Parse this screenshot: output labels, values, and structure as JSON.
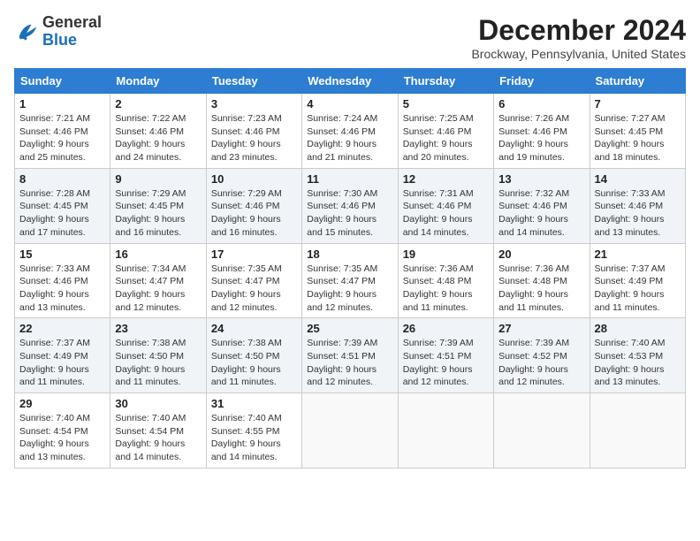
{
  "logo": {
    "general": "General",
    "blue": "Blue"
  },
  "title": "December 2024",
  "subtitle": "Brockway, Pennsylvania, United States",
  "days_of_week": [
    "Sunday",
    "Monday",
    "Tuesday",
    "Wednesday",
    "Thursday",
    "Friday",
    "Saturday"
  ],
  "weeks": [
    [
      {
        "day": 1,
        "sunrise": "7:21 AM",
        "sunset": "4:46 PM",
        "daylight": "9 hours and 25 minutes."
      },
      {
        "day": 2,
        "sunrise": "7:22 AM",
        "sunset": "4:46 PM",
        "daylight": "9 hours and 24 minutes."
      },
      {
        "day": 3,
        "sunrise": "7:23 AM",
        "sunset": "4:46 PM",
        "daylight": "9 hours and 23 minutes."
      },
      {
        "day": 4,
        "sunrise": "7:24 AM",
        "sunset": "4:46 PM",
        "daylight": "9 hours and 21 minutes."
      },
      {
        "day": 5,
        "sunrise": "7:25 AM",
        "sunset": "4:46 PM",
        "daylight": "9 hours and 20 minutes."
      },
      {
        "day": 6,
        "sunrise": "7:26 AM",
        "sunset": "4:46 PM",
        "daylight": "9 hours and 19 minutes."
      },
      {
        "day": 7,
        "sunrise": "7:27 AM",
        "sunset": "4:45 PM",
        "daylight": "9 hours and 18 minutes."
      }
    ],
    [
      {
        "day": 8,
        "sunrise": "7:28 AM",
        "sunset": "4:45 PM",
        "daylight": "9 hours and 17 minutes."
      },
      {
        "day": 9,
        "sunrise": "7:29 AM",
        "sunset": "4:45 PM",
        "daylight": "9 hours and 16 minutes."
      },
      {
        "day": 10,
        "sunrise": "7:29 AM",
        "sunset": "4:46 PM",
        "daylight": "9 hours and 16 minutes."
      },
      {
        "day": 11,
        "sunrise": "7:30 AM",
        "sunset": "4:46 PM",
        "daylight": "9 hours and 15 minutes."
      },
      {
        "day": 12,
        "sunrise": "7:31 AM",
        "sunset": "4:46 PM",
        "daylight": "9 hours and 14 minutes."
      },
      {
        "day": 13,
        "sunrise": "7:32 AM",
        "sunset": "4:46 PM",
        "daylight": "9 hours and 14 minutes."
      },
      {
        "day": 14,
        "sunrise": "7:33 AM",
        "sunset": "4:46 PM",
        "daylight": "9 hours and 13 minutes."
      }
    ],
    [
      {
        "day": 15,
        "sunrise": "7:33 AM",
        "sunset": "4:46 PM",
        "daylight": "9 hours and 13 minutes."
      },
      {
        "day": 16,
        "sunrise": "7:34 AM",
        "sunset": "4:47 PM",
        "daylight": "9 hours and 12 minutes."
      },
      {
        "day": 17,
        "sunrise": "7:35 AM",
        "sunset": "4:47 PM",
        "daylight": "9 hours and 12 minutes."
      },
      {
        "day": 18,
        "sunrise": "7:35 AM",
        "sunset": "4:47 PM",
        "daylight": "9 hours and 12 minutes."
      },
      {
        "day": 19,
        "sunrise": "7:36 AM",
        "sunset": "4:48 PM",
        "daylight": "9 hours and 11 minutes."
      },
      {
        "day": 20,
        "sunrise": "7:36 AM",
        "sunset": "4:48 PM",
        "daylight": "9 hours and 11 minutes."
      },
      {
        "day": 21,
        "sunrise": "7:37 AM",
        "sunset": "4:49 PM",
        "daylight": "9 hours and 11 minutes."
      }
    ],
    [
      {
        "day": 22,
        "sunrise": "7:37 AM",
        "sunset": "4:49 PM",
        "daylight": "9 hours and 11 minutes."
      },
      {
        "day": 23,
        "sunrise": "7:38 AM",
        "sunset": "4:50 PM",
        "daylight": "9 hours and 11 minutes."
      },
      {
        "day": 24,
        "sunrise": "7:38 AM",
        "sunset": "4:50 PM",
        "daylight": "9 hours and 11 minutes."
      },
      {
        "day": 25,
        "sunrise": "7:39 AM",
        "sunset": "4:51 PM",
        "daylight": "9 hours and 12 minutes."
      },
      {
        "day": 26,
        "sunrise": "7:39 AM",
        "sunset": "4:51 PM",
        "daylight": "9 hours and 12 minutes."
      },
      {
        "day": 27,
        "sunrise": "7:39 AM",
        "sunset": "4:52 PM",
        "daylight": "9 hours and 12 minutes."
      },
      {
        "day": 28,
        "sunrise": "7:40 AM",
        "sunset": "4:53 PM",
        "daylight": "9 hours and 13 minutes."
      }
    ],
    [
      {
        "day": 29,
        "sunrise": "7:40 AM",
        "sunset": "4:54 PM",
        "daylight": "9 hours and 13 minutes."
      },
      {
        "day": 30,
        "sunrise": "7:40 AM",
        "sunset": "4:54 PM",
        "daylight": "9 hours and 14 minutes."
      },
      {
        "day": 31,
        "sunrise": "7:40 AM",
        "sunset": "4:55 PM",
        "daylight": "9 hours and 14 minutes."
      },
      null,
      null,
      null,
      null
    ]
  ],
  "labels": {
    "sunrise": "Sunrise:",
    "sunset": "Sunset:",
    "daylight": "Daylight:"
  }
}
